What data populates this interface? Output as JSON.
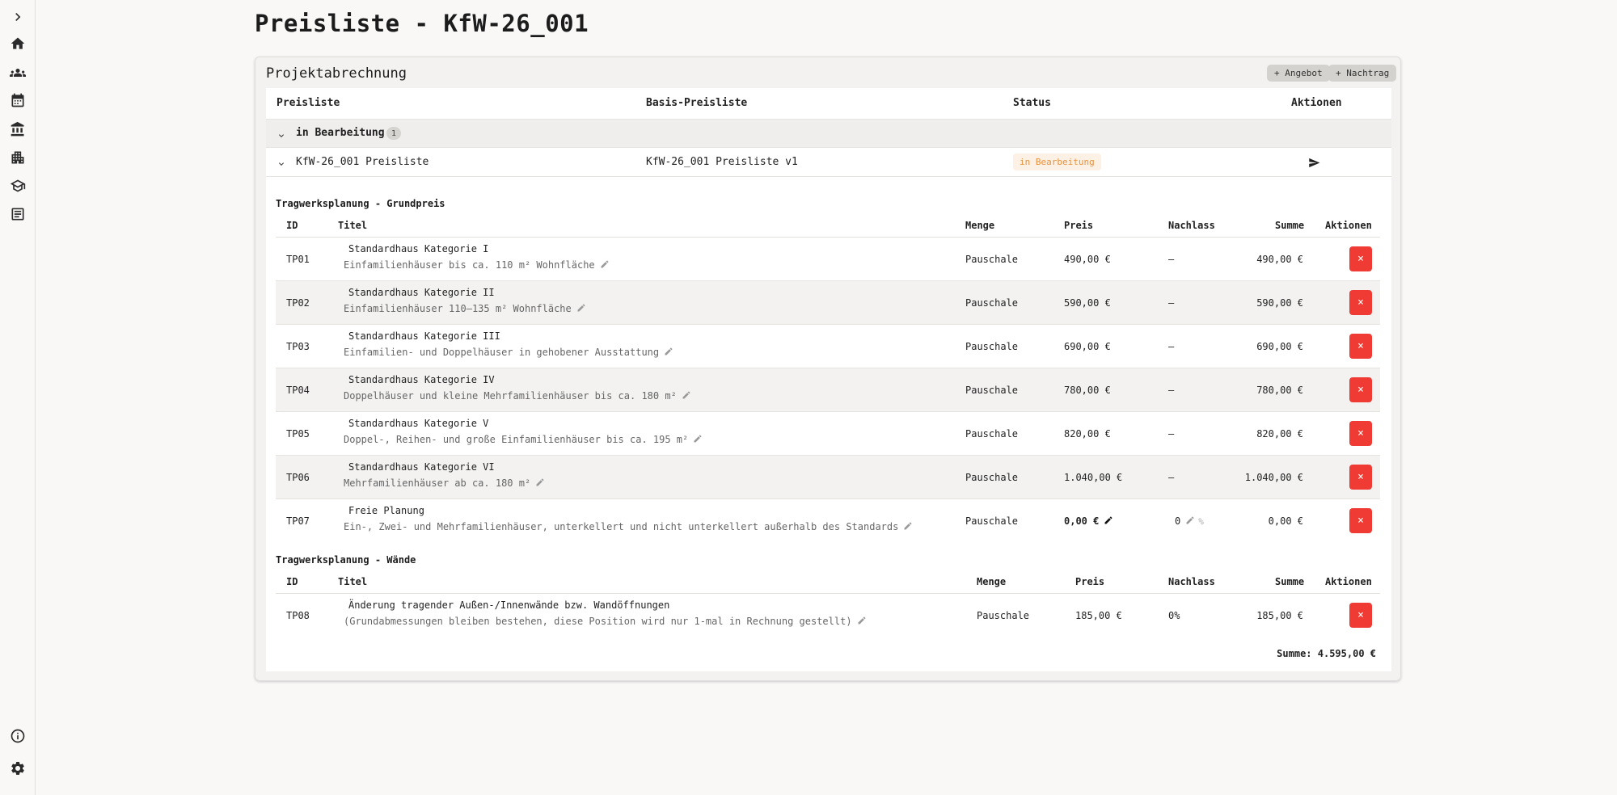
{
  "page": {
    "title": "Preisliste - KfW-26_001"
  },
  "sidebar": {
    "icons": [
      "chevron-right-icon",
      "home-icon",
      "group-icon",
      "calendar-icon",
      "bank-icon",
      "building-icon",
      "apartment-icon",
      "receipt-icon",
      "info-icon",
      "settings-icon"
    ]
  },
  "card": {
    "title": "Projektabrechnung",
    "btn_angebot": "+ Angebot",
    "btn_nachtrag": "+ Nachtrag"
  },
  "list_head": {
    "col1": "Preisliste",
    "col2": "Basis-Preisliste",
    "col3": "Status",
    "col4": "Aktionen"
  },
  "group": {
    "label": "in Bearbeitung",
    "count": "1"
  },
  "pricelist": {
    "name": "KfW-26_001 Preisliste",
    "base": "KfW-26_001 Preisliste v1",
    "status": "in Bearbeitung"
  },
  "item_head": {
    "id": "ID",
    "title": "Titel",
    "qty": "Menge",
    "price": "Preis",
    "discount": "Nachlass",
    "sum": "Summe",
    "actions": "Aktionen"
  },
  "section1": {
    "title": "Tragwerksplanung - Grundpreis",
    "rows": [
      {
        "id": "TP01",
        "title": "Standardhaus Kategorie I",
        "desc": "Einfamilienhäuser bis ca. 110 m² Wohnfläche",
        "qty": "Pauschale",
        "price": "490,00 €",
        "discount": "–",
        "sum": "490,00 €"
      },
      {
        "id": "TP02",
        "title": "Standardhaus Kategorie II",
        "desc": "Einfamilienhäuser 110–135 m² Wohnfläche",
        "qty": "Pauschale",
        "price": "590,00 €",
        "discount": "–",
        "sum": "590,00 €"
      },
      {
        "id": "TP03",
        "title": "Standardhaus Kategorie III",
        "desc": "Einfamilien- und Doppelhäuser in gehobener Ausstattung",
        "qty": "Pauschale",
        "price": "690,00 €",
        "discount": "–",
        "sum": "690,00 €"
      },
      {
        "id": "TP04",
        "title": "Standardhaus Kategorie IV",
        "desc": "Doppelhäuser und kleine Mehrfamilienhäuser bis ca. 180 m²",
        "qty": "Pauschale",
        "price": "780,00 €",
        "discount": "–",
        "sum": "780,00 €"
      },
      {
        "id": "TP05",
        "title": "Standardhaus Kategorie V",
        "desc": "Doppel-, Reihen- und große Einfamilienhäuser bis ca. 195 m²",
        "qty": "Pauschale",
        "price": "820,00 €",
        "discount": "–",
        "sum": "820,00 €"
      },
      {
        "id": "TP06",
        "title": "Standardhaus Kategorie VI",
        "desc": "Mehrfamilienhäuser ab ca. 180 m²",
        "qty": "Pauschale",
        "price": "1.040,00 €",
        "discount": "–",
        "sum": "1.040,00 €"
      },
      {
        "id": "TP07",
        "title": "Freie Planung",
        "desc": "Ein-, Zwei- und Mehrfamilienhäuser, unterkellert und nicht unterkellert außerhalb des Standards",
        "qty": "Pauschale",
        "price": "0,00 €",
        "discount": "0",
        "discount_unit": "%",
        "sum": "0,00 €"
      }
    ]
  },
  "section2": {
    "title": "Tragwerksplanung - Wände",
    "rows": [
      {
        "id": "TP08",
        "title": "Änderung tragender Außen-/Innenwände bzw. Wandöffnungen",
        "desc": "(Grundabmessungen bleiben bestehen, diese Position wird nur 1-mal in Rechnung gestellt)",
        "qty": "Pauschale",
        "price": "185,00 €",
        "discount": "0%",
        "sum": "185,00 €"
      }
    ]
  },
  "total": "Summe: 4.595,00 €",
  "delete_label": "×",
  "colors": {
    "delete": "#ef3b33",
    "status_text": "#e8913c",
    "status_bg": "#fdf0e4"
  }
}
